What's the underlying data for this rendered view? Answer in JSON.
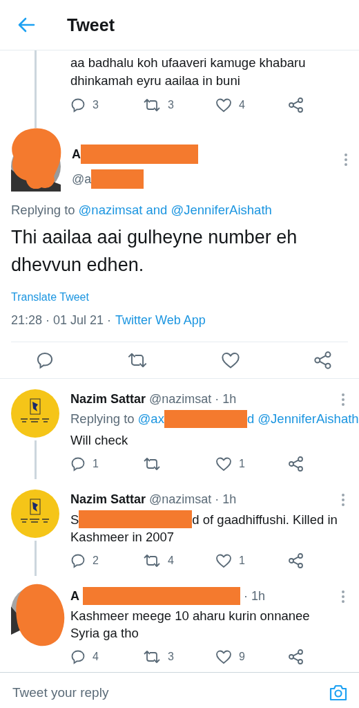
{
  "header": {
    "title": "Tweet"
  },
  "parent_tweet": {
    "text": "aa badhalu koh ufaaveri kamuge khabaru dhinkamah eyru aailaa in buni",
    "counts": {
      "reply": "3",
      "retweet": "3",
      "like": "4"
    }
  },
  "main_tweet": {
    "name_visible": "A",
    "handle_visible": "@a",
    "replying_label": "Replying to",
    "replying_to": "@nazimsat and @JenniferAishath",
    "text": "Thi aailaa aai gulheyne number eh dhevvun edhen.",
    "translate": "Translate Tweet",
    "timestamp": "21:28 · 01 Jul 21 ·",
    "source": "Twitter Web App"
  },
  "replies": [
    {
      "kind": "logo",
      "name": "Nazim Sattar",
      "handle": "@nazimsat · 1h",
      "replying_label": "Replying to",
      "replying_before": "@ax",
      "replying_after": "d @JenniferAishath",
      "text": "Will check",
      "counts": {
        "reply": "1",
        "like": "1"
      }
    },
    {
      "kind": "logo",
      "name": "Nazim Sattar",
      "handle": "@nazimsat · 1h",
      "text_before": "S",
      "text_after": "d of gaadhiffushi. Killed in",
      "text": "Kashmeer in 2007",
      "counts": {
        "reply": "2",
        "retweet": "4",
        "like": "1"
      }
    },
    {
      "kind": "redacted",
      "name": "A",
      "handle": "· 1h",
      "text": "Kashmeer meege 10 aharu kurin onnanee Syria ga tho",
      "counts": {
        "reply": "4",
        "retweet": "3",
        "like": "9"
      }
    }
  ],
  "reply_box": {
    "placeholder": "Tweet your reply"
  }
}
